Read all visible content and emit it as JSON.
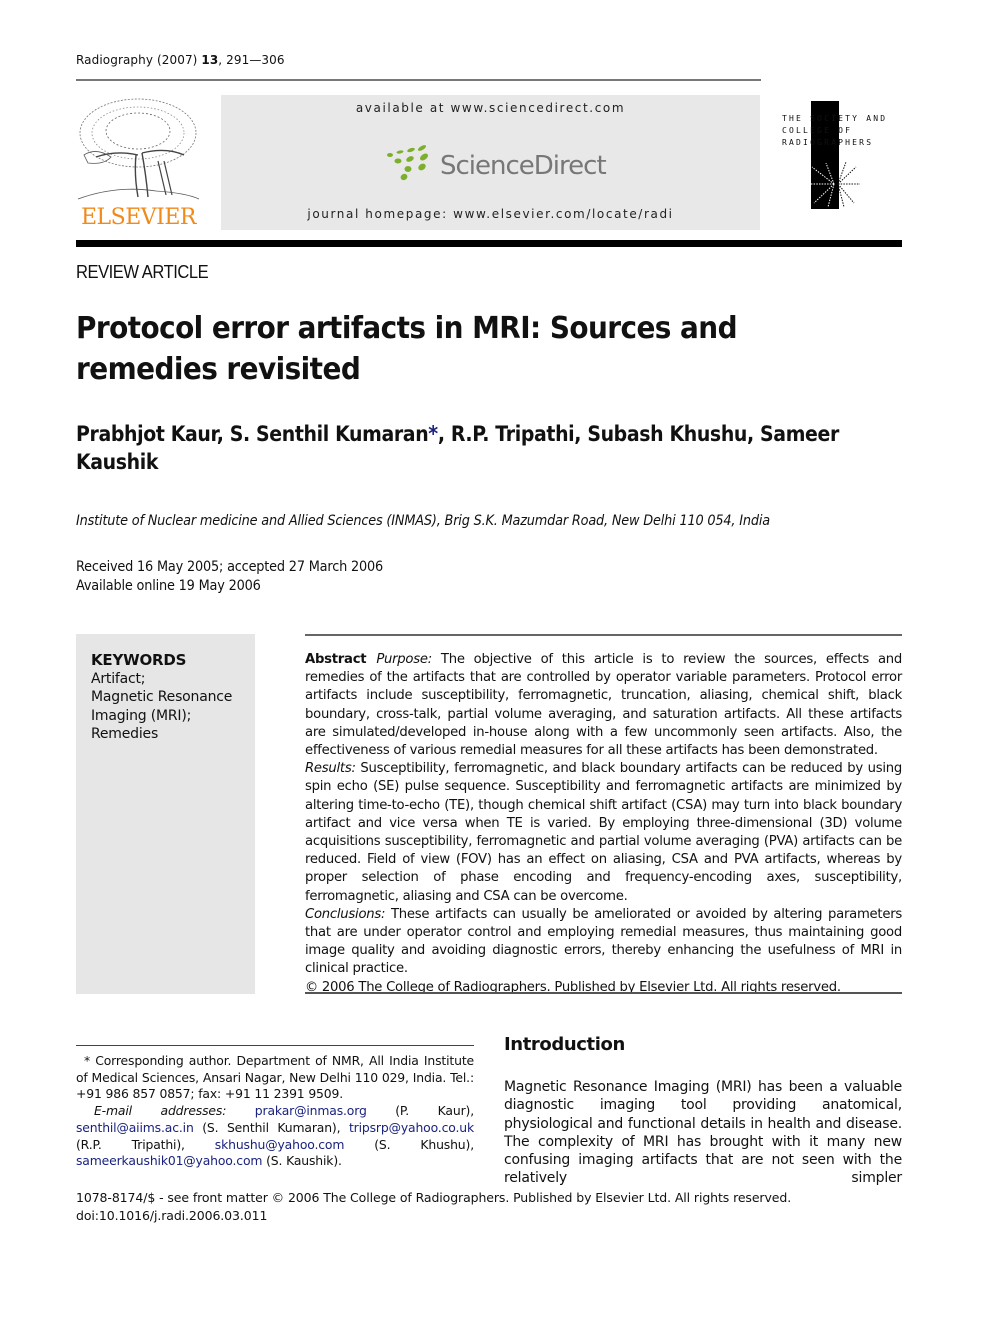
{
  "journal": {
    "citation_prefix": "Radiography (2007) ",
    "volume": "13",
    "pages": ", 291—306"
  },
  "header": {
    "publisher_logo_text": "ELSEVIER",
    "available_at": "available at www.sciencedirect.com",
    "sciencedirect_logo_text": "ScienceDirect",
    "journal_homepage": "journal homepage: www.elsevier.com/locate/radi",
    "society_logo_lines": [
      "THE SOCIETY AND",
      "COLLEGE OF",
      "RADIOGRAPHERS"
    ]
  },
  "colors": {
    "elsevier_orange": "#f08a1a",
    "sciencedirect_green": "#7cb02c",
    "link_blue": "#1a237e",
    "keyword_box_gray": "#e6e6e6"
  },
  "article": {
    "type": "REVIEW ARTICLE",
    "title": "Protocol error artifacts in MRI: Sources and remedies revisited",
    "authors_part1": "Prabhjot Kaur, S. Senthil Kumaran",
    "corresponding_mark": "*",
    "authors_part2": ", R.P. Tripathi, Subash Khushu, Sameer Kaushik",
    "affiliation": "Institute of Nuclear medicine and Allied Sciences (INMAS), Brig S.K. Mazumdar Road, New Delhi 110 054, India",
    "received": "Received 16 May 2005; accepted 27 March 2006",
    "available_online": "Available online 19 May 2006"
  },
  "keywords": {
    "heading": "KEYWORDS",
    "items": [
      "Artifact;",
      "Magnetic Resonance Imaging (MRI);",
      "Remedies"
    ]
  },
  "abstract": {
    "label": "Abstract",
    "purpose_label": "Purpose:",
    "purpose": " The objective of this article is to review the sources, effects and remedies of the artifacts that are controlled by operator variable parameters. Protocol error artifacts include susceptibility, ferromagnetic, truncation, aliasing, chemical shift, black boundary, cross-talk, partial volume averaging, and saturation artifacts. All these artifacts are simulated/developed in-house along with a few uncommonly seen artifacts. Also, the effectiveness of various remedial measures for all these artifacts has been demonstrated.",
    "results_label": "Results:",
    "results": " Susceptibility, ferromagnetic, and black boundary artifacts can be reduced by using spin echo (SE) pulse sequence. Susceptibility and ferromagnetic artifacts are minimized by altering time-to-echo (TE), though chemical shift artifact (CSA) may turn into black boundary artifact and vice versa when TE is varied. By employing three-dimensional (3D) volume acquisitions susceptibility, ferromagnetic and partial volume averaging (PVA) artifacts can be reduced. Field of view (FOV) has an effect on aliasing, CSA and PVA artifacts, whereas by proper selection of phase encoding and frequency-encoding axes, susceptibility, ferromagnetic, aliasing and CSA can be overcome.",
    "conclusions_label": "Conclusions:",
    "conclusions": " These artifacts can usually be ameliorated or avoided by altering parameters that are under operator control and employing remedial measures, thus maintaining good image quality and avoiding diagnostic errors, thereby enhancing the usefulness of MRI in clinical practice.",
    "copyright": "© 2006 The College of Radiographers. Published by Elsevier Ltd. All rights reserved."
  },
  "footnote": {
    "corresponding": "* Corresponding author. Department of NMR, All India Institute of Medical Sciences, Ansari Nagar, New Delhi 110 029, India. Tel.: +91 986 857 0857; fax: +91 11 2391 9509.",
    "email_label": "E-mail addresses:",
    "emails": [
      {
        "address": "prakar@inmas.org",
        "owner": " (P. Kaur), "
      },
      {
        "address": "senthil@aiims.ac.in",
        "owner": " (S. Senthil Kumaran), "
      },
      {
        "address": "tripsrp@yahoo.co.uk",
        "owner": " (R.P. Tripathi), "
      },
      {
        "address": "skhushu@yahoo.com",
        "owner": " (S. Khushu), "
      },
      {
        "address": "sameerkaushik01@yahoo.com",
        "owner": " (S. Kaushik)."
      }
    ]
  },
  "introduction": {
    "heading": "Introduction",
    "text": "Magnetic Resonance Imaging (MRI) has been a valuable diagnostic imaging tool providing anatomical, physiological and functional details in health and disease. The complexity of MRI has brought with it many new confusing imaging artifacts that are not seen with the relatively simpler"
  },
  "footer": {
    "issn_line": "1078-8174/$ - see front matter © 2006 The College of Radiographers. Published by Elsevier Ltd. All rights reserved.",
    "doi": "doi:10.1016/j.radi.2006.03.011"
  }
}
